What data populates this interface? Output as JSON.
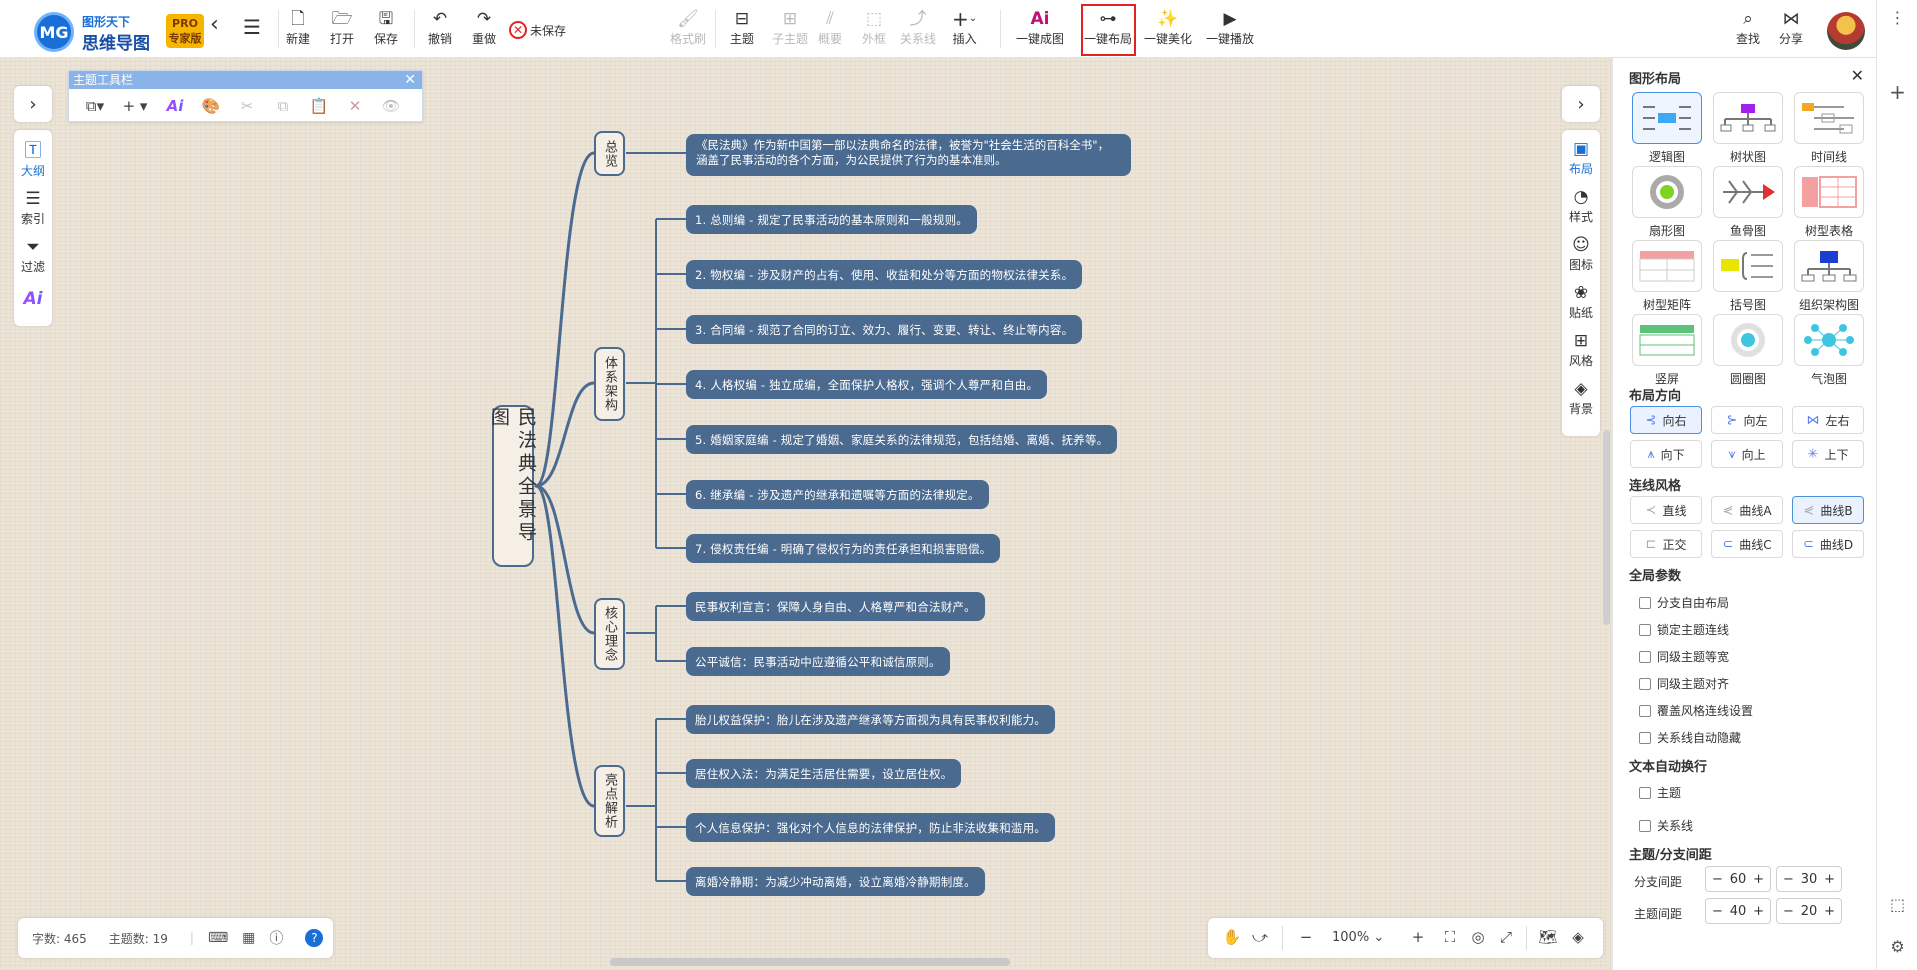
{
  "app": {
    "logo_line1": "图形天下",
    "logo_line2": "思维导图",
    "logo_badge": "MG",
    "pro_line1": "PRO",
    "pro_line2": "专家版"
  },
  "toolbar": {
    "new": "新建",
    "open": "打开",
    "save": "保存",
    "undo": "撤销",
    "redo": "重做",
    "unsaved": "未保存",
    "format_brush": "格式刷",
    "topic": "主题",
    "subtopic": "子主题",
    "summary": "概要",
    "frame": "外框",
    "relation": "关系线",
    "insert": "插入",
    "ai_map": "一键成图",
    "ai_map_icon": "Ai",
    "auto_layout": "一键布局",
    "beautify": "一键美化",
    "play": "一键播放",
    "search": "查找",
    "share": "分享"
  },
  "left_panel": {
    "outline": "大纲",
    "index": "索引",
    "filter": "过滤",
    "ai": "Ai"
  },
  "topic_toolbar": {
    "title": "主题工具栏",
    "ai": "Ai"
  },
  "right_strip": {
    "layout": "布局",
    "style": "样式",
    "icon": "图标",
    "sticker": "贴纸",
    "style_grid": "风格",
    "background": "背景"
  },
  "panel": {
    "title": "图形布局",
    "layouts": [
      "逻辑图",
      "树状图",
      "时间线",
      "扇形图",
      "鱼骨图",
      "树型表格",
      "树型矩阵",
      "括号图",
      "组织架构图",
      "竖屏",
      "圆圈图",
      "气泡图"
    ],
    "direction_title": "布局方向",
    "directions": [
      "向右",
      "向左",
      "左右",
      "向下",
      "向上",
      "上下"
    ],
    "line_title": "连线风格",
    "lines": [
      "直线",
      "曲线A",
      "曲线B",
      "正交",
      "曲线C",
      "曲线D"
    ],
    "params_title": "全局参数",
    "params": [
      "分支自由布局",
      "锁定主题连线",
      "同级主题等宽",
      "同级主题对齐",
      "覆盖风格连线设置",
      "关系线自动隐藏"
    ],
    "wrap_title": "文本自动换行",
    "wrap": [
      "主题",
      "关系线"
    ],
    "spacing_title": "主题/分支间距",
    "branch_spacing_label": "分支间距",
    "topic_spacing_label": "主题间距",
    "branch_spacing": [
      "60",
      "30"
    ],
    "topic_spacing": [
      "40",
      "20"
    ]
  },
  "status": {
    "word_count": "字数: 465",
    "topic_count": "主题数: 19"
  },
  "zoom": {
    "level": "100%"
  },
  "mindmap": {
    "root": "民法典全景导图",
    "branches": [
      {
        "label": "总览",
        "children": [
          "《民法典》作为新中国第一部以法典命名的法律，被誉为\"社会生活的百科全书\"，",
          "涵盖了民事活动的各个方面，为公民提供了行为的基本准则。"
        ]
      },
      {
        "label": "体系架构",
        "children": [
          "1. 总则编 - 规定了民事活动的基本原则和一般规则。",
          "2. 物权编 - 涉及财产的占有、使用、收益和处分等方面的物权法律关系。",
          "3. 合同编 - 规范了合同的订立、效力、履行、变更、转让、终止等内容。",
          "4. 人格权编 - 独立成编，全面保护人格权，强调个人尊严和自由。",
          "5. 婚姻家庭编 - 规定了婚姻、家庭关系的法律规范，包括结婚、离婚、抚养等。",
          "6. 继承编 - 涉及遗产的继承和遗嘱等方面的法律规定。",
          "7. 侵权责任编 - 明确了侵权行为的责任承担和损害赔偿。"
        ]
      },
      {
        "label": "核心理念",
        "children": [
          "民事权利宣言：保障人身自由、人格尊严和合法财产。",
          "公平诚信：民事活动中应遵循公平和诚信原则。"
        ]
      },
      {
        "label": "亮点解析",
        "children": [
          "胎儿权益保护：胎儿在涉及遗产继承等方面视为具有民事权利能力。",
          "居住权入法：为满足生活居住需要，设立居住权。",
          "个人信息保护：强化对个人信息的法律保护，防止非法收集和滥用。",
          "离婚冷静期：为减少冲动离婚，设立离婚冷静期制度。"
        ]
      }
    ]
  },
  "colors": {
    "node": "#4a6a8f",
    "accent": "#1a6fd6",
    "highlight": "#e52222",
    "canvas": "#ede4d8"
  }
}
